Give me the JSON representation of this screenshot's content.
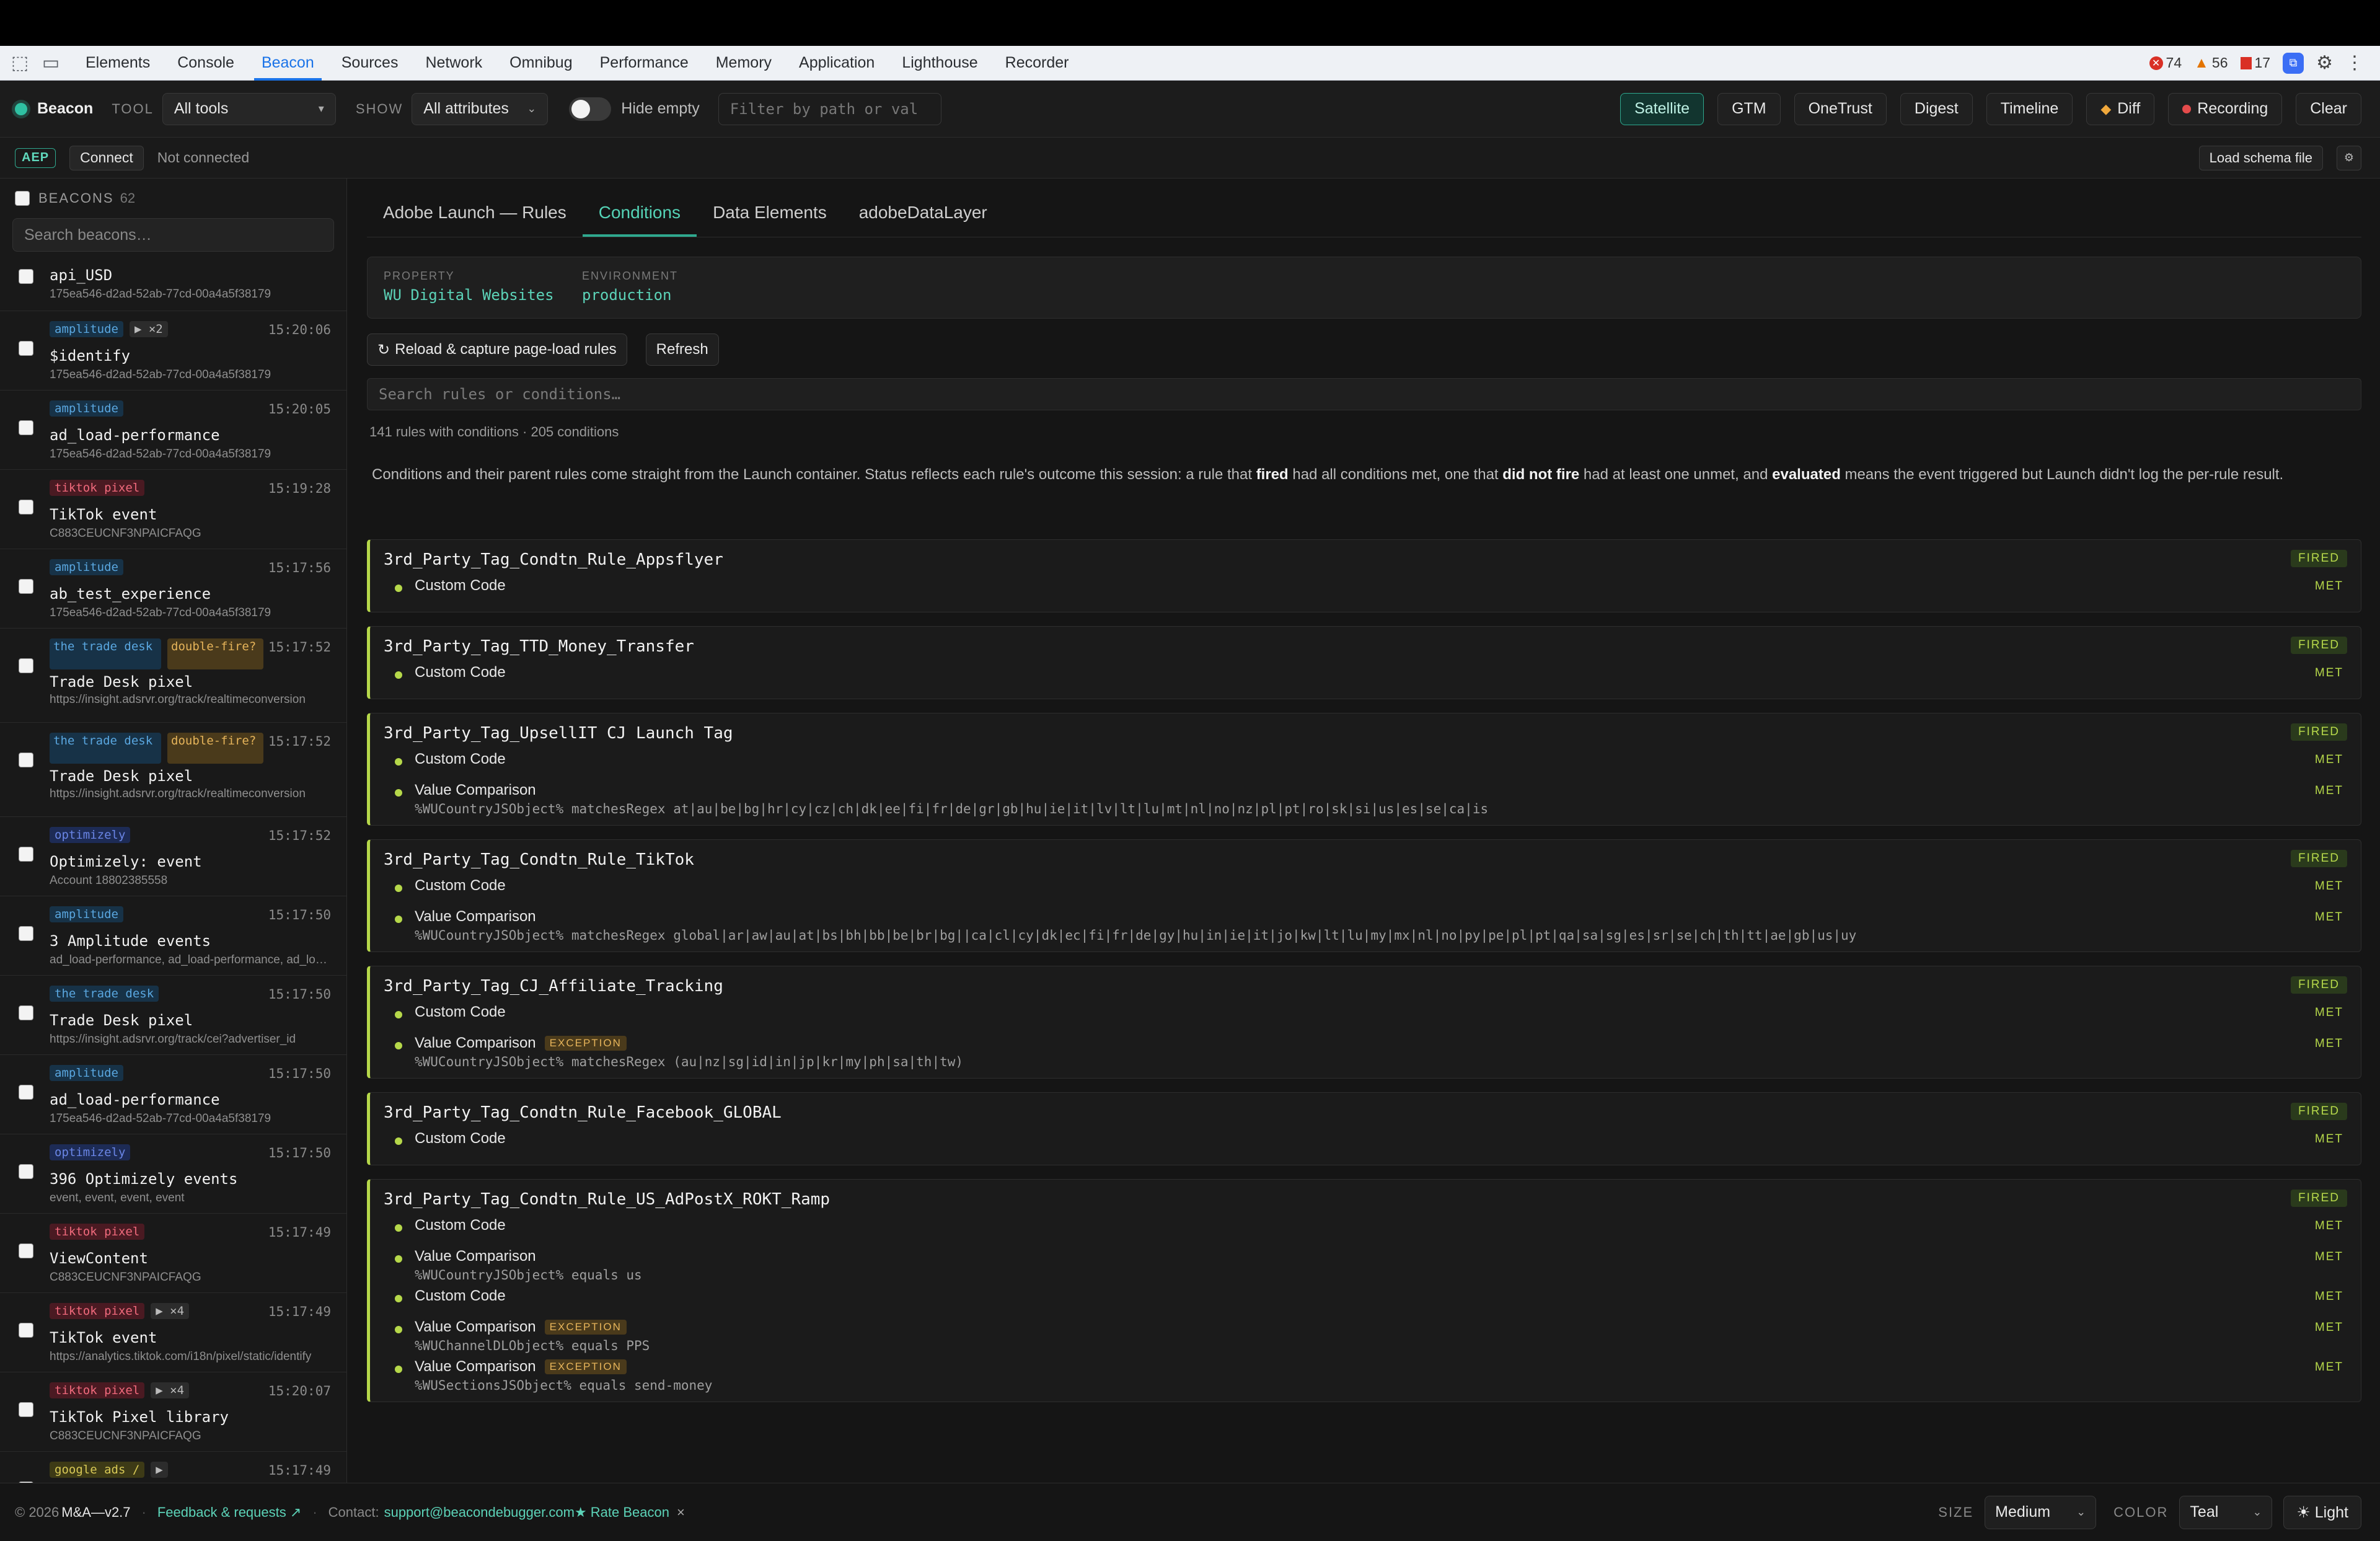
{
  "devtools": {
    "tabs": [
      "Elements",
      "Console",
      "Beacon",
      "Sources",
      "Network",
      "Omnibug",
      "Performance",
      "Memory",
      "Application",
      "Lighthouse",
      "Recorder"
    ],
    "active_tab": "Beacon",
    "errors": "74",
    "warnings": "56",
    "issues": "17"
  },
  "toolbar": {
    "brand": "Beacon",
    "tool_label": "TOOL",
    "tool_value": "All tools",
    "show_label": "SHOW",
    "show_value": "All attributes",
    "hide_empty": "Hide empty",
    "filter_placeholder": "Filter by path or val",
    "buttons": [
      "Satellite",
      "GTM",
      "OneTrust",
      "Digest",
      "Timeline",
      "Diff",
      "Recording",
      "Clear"
    ]
  },
  "toolbar2": {
    "aep": "AEP",
    "connect": "Connect",
    "status": "Not connected",
    "load_schema": "Load schema file",
    "settings_glyph": "⚙"
  },
  "sidebar": {
    "title": "BEACONS",
    "count": "62",
    "search_placeholder": "Search beacons…",
    "items": [
      {
        "name": "api_USD",
        "sub": "175ea546-d2ad-52ab-77cd-00a4a5f38179"
      },
      {
        "tag": "amplitude",
        "extra": "▶ ×2",
        "time": "15:20:06",
        "name": "$identify",
        "sub": "175ea546-d2ad-52ab-77cd-00a4a5f38179"
      },
      {
        "tag": "amplitude",
        "time": "15:20:05",
        "name": "ad_load-performance",
        "sub": "175ea546-d2ad-52ab-77cd-00a4a5f38179"
      },
      {
        "tag": "tiktok pixel",
        "time": "15:19:28",
        "name": "TikTok event",
        "sub": "C883CEUCNF3NPAICFAQG"
      },
      {
        "tag": "amplitude",
        "time": "15:17:56",
        "name": "ab_test_experience",
        "sub": "175ea546-d2ad-52ab-77cd-00a4a5f38179"
      },
      {
        "tag": "the trade desk",
        "extra": "double-fire?",
        "time": "15:17:52",
        "name": "Trade Desk pixel",
        "sub": "https://insight.adsrvr.org/track/realtimeconversion"
      },
      {
        "tag": "the trade desk",
        "extra": "double-fire?",
        "time": "15:17:52",
        "name": "Trade Desk pixel",
        "sub": "https://insight.adsrvr.org/track/realtimeconversion"
      },
      {
        "tag": "optimizely",
        "time": "15:17:52",
        "name": "Optimizely: event",
        "sub": "Account 18802385558"
      },
      {
        "tag": "amplitude",
        "time": "15:17:50",
        "name": "3 Amplitude events",
        "sub": "ad_load-performance, ad_load-performance, ad_load-performance"
      },
      {
        "tag": "the trade desk",
        "time": "15:17:50",
        "name": "Trade Desk pixel",
        "sub": "https://insight.adsrvr.org/track/cei?advertiser_id"
      },
      {
        "tag": "amplitude",
        "time": "15:17:50",
        "name": "ad_load-performance",
        "sub": "175ea546-d2ad-52ab-77cd-00a4a5f38179"
      },
      {
        "tag": "optimizely",
        "time": "15:17:50",
        "name": "396 Optimizely events",
        "sub": "event, event, event, event"
      },
      {
        "tag": "tiktok pixel",
        "time": "15:17:49",
        "name": "ViewContent",
        "sub": "C883CEUCNF3NPAICFAQG"
      },
      {
        "tag": "tiktok pixel",
        "extra": "▶ ×4",
        "time": "15:17:49",
        "name": "TikTok event",
        "sub": "https://analytics.tiktok.com/i18n/pixel/static/identify"
      },
      {
        "tag": "tiktok pixel",
        "extra": "▶ ×4",
        "time": "15:20:07",
        "name": "TikTok Pixel library",
        "sub": "C883CEUCNF3NPAICFAQG"
      },
      {
        "tag": "google ads /",
        "extra": "▶",
        "time": "15:17:49",
        "name": "",
        "sub": ""
      }
    ]
  },
  "main": {
    "tabs": [
      "Adobe Launch — Rules",
      "Conditions",
      "Data Elements",
      "adobeDataLayer"
    ],
    "active_tab": "Conditions",
    "property_label": "PROPERTY",
    "property_value": "WU Digital Websites",
    "environment_label": "ENVIRONMENT",
    "environment_value": "production",
    "reload_button": "Reload & capture page-load rules",
    "refresh_button": "Refresh",
    "search_placeholder": "Search rules or conditions…",
    "rule_count": "141 rules with conditions · 205 conditions",
    "explain_1": "Conditions and their parent rules come straight from the Launch container. Status reflects each rule's outcome this session: a rule that ",
    "explain_fired": "fired",
    "explain_2": " had all conditions met, one that ",
    "explain_notfired": "did not fire",
    "explain_3": " had at least one unmet, and ",
    "explain_evaluated": "evaluated",
    "explain_4": " means the event triggered but Launch didn't log the per-rule result.",
    "status_fired": "FIRED",
    "status_met": "MET",
    "exception_label": "EXCEPTION",
    "rules": [
      {
        "name": "3rd_Party_Tag_Condtn_Rule_Appsflyer",
        "conditions": [
          {
            "name": "Custom Code"
          }
        ]
      },
      {
        "name": "3rd_Party_Tag_TTD_Money_Transfer",
        "conditions": [
          {
            "name": "Custom Code"
          }
        ]
      },
      {
        "name": "3rd_Party_Tag_UpsellIT CJ Launch Tag",
        "conditions": [
          {
            "name": "Custom Code"
          },
          {
            "name": "Value Comparison",
            "detail": "%WUCountryJSObject% matchesRegex at|au|be|bg|hr|cy|cz|ch|dk|ee|fi|fr|de|gr|gb|hu|ie|it|lv|lt|lu|mt|nl|no|nz|pl|pt|ro|sk|si|us|es|se|ca|is"
          }
        ]
      },
      {
        "name": "3rd_Party_Tag_Condtn_Rule_TikTok",
        "conditions": [
          {
            "name": "Custom Code"
          },
          {
            "name": "Value Comparison",
            "detail": "%WUCountryJSObject% matchesRegex global|ar|aw|au|at|bs|bh|bb|be|br|bg||ca|cl|cy|dk|ec|fi|fr|de|gy|hu|in|ie|it|jo|kw|lt|lu|my|mx|nl|no|py|pe|pl|pt|qa|sa|sg|es|sr|se|ch|th|tt|ae|gb|us|uy"
          }
        ]
      },
      {
        "name": "3rd_Party_Tag_CJ_Affiliate_Tracking",
        "conditions": [
          {
            "name": "Custom Code"
          },
          {
            "name": "Value Comparison",
            "exception": true,
            "detail": "%WUCountryJSObject% matchesRegex (au|nz|sg|id|in|jp|kr|my|ph|sa|th|tw)"
          }
        ]
      },
      {
        "name": "3rd_Party_Tag_Condtn_Rule_Facebook_GLOBAL",
        "conditions": [
          {
            "name": "Custom Code"
          }
        ]
      },
      {
        "name": "3rd_Party_Tag_Condtn_Rule_US_AdPostX_ROKT_Ramp",
        "conditions": [
          {
            "name": "Custom Code"
          },
          {
            "name": "Value Comparison",
            "detail": "%WUCountryJSObject% equals us"
          },
          {
            "name": "Custom Code"
          },
          {
            "name": "Value Comparison",
            "exception": true,
            "detail": "%WUChannelDLObject% equals PPS"
          },
          {
            "name": "Value Comparison",
            "exception": true,
            "detail": "%WUSectionsJSObject% equals send-money"
          }
        ]
      }
    ]
  },
  "footer": {
    "copyright": "© 2026",
    "version": "M&A—v2.7",
    "feedback": "Feedback & requests ↗",
    "contact_label": "Contact:",
    "contact_email": "support@beacondebugger.com",
    "rate": "★ Rate Beacon",
    "rate_close": "×",
    "size_label": "SIZE",
    "size_value": "Medium",
    "color_label": "COLOR",
    "color_value": "Teal",
    "theme_button": "☀ Light"
  },
  "colors": {
    "accent": "#2fa88e",
    "fired": "#b6d84a",
    "devtools_active": "#1a73e8"
  }
}
